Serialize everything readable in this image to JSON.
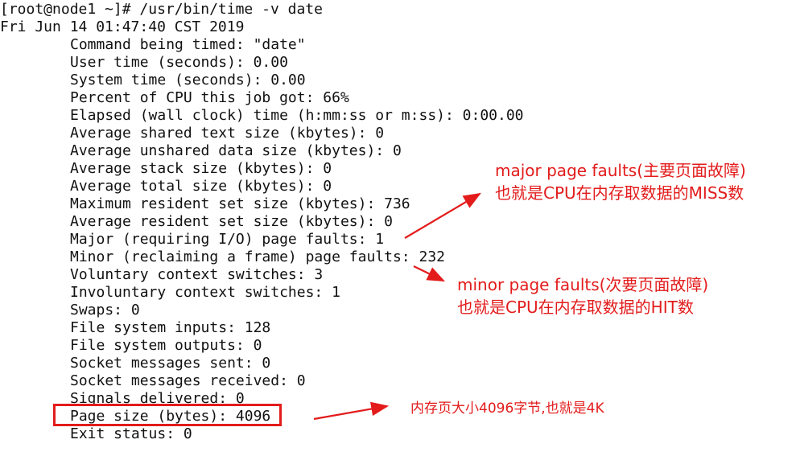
{
  "terminal": {
    "prompt": "[root@node1 ~]# /usr/bin/time -v date",
    "date_output": "Fri Jun 14 01:47:40 CST 2019",
    "lines": [
      "Command being timed: \"date\"",
      "User time (seconds): 0.00",
      "System time (seconds): 0.00",
      "Percent of CPU this job got: 66%",
      "Elapsed (wall clock) time (h:mm:ss or m:ss): 0:00.00",
      "Average shared text size (kbytes): 0",
      "Average unshared data size (kbytes): 0",
      "Average stack size (kbytes): 0",
      "Average total size (kbytes): 0",
      "Maximum resident set size (kbytes): 736",
      "Average resident set size (kbytes): 0",
      "Major (requiring I/O) page faults: 1",
      "Minor (reclaiming a frame) page faults: 232",
      "Voluntary context switches: 3",
      "Involuntary context switches: 1",
      "Swaps: 0",
      "File system inputs: 128",
      "File system outputs: 0",
      "Socket messages sent: 0",
      "Socket messages received: 0",
      "Signals delivered: 0",
      "Page size (bytes): 4096",
      "Exit status: 0"
    ]
  },
  "annotations": {
    "major_line1": "major page faults(主要页面故障)",
    "major_line2": "也就是CPU在内存取数据的MISS数",
    "minor_line1": "minor page faults(次要页面故障)",
    "minor_line2": "也就是CPU在内存取数据的HIT数",
    "page_size": "内存页大小4096字节,也就是4K"
  },
  "colors": {
    "annotation": "#e31b1b",
    "text": "#111111",
    "background": "#ffffff"
  }
}
